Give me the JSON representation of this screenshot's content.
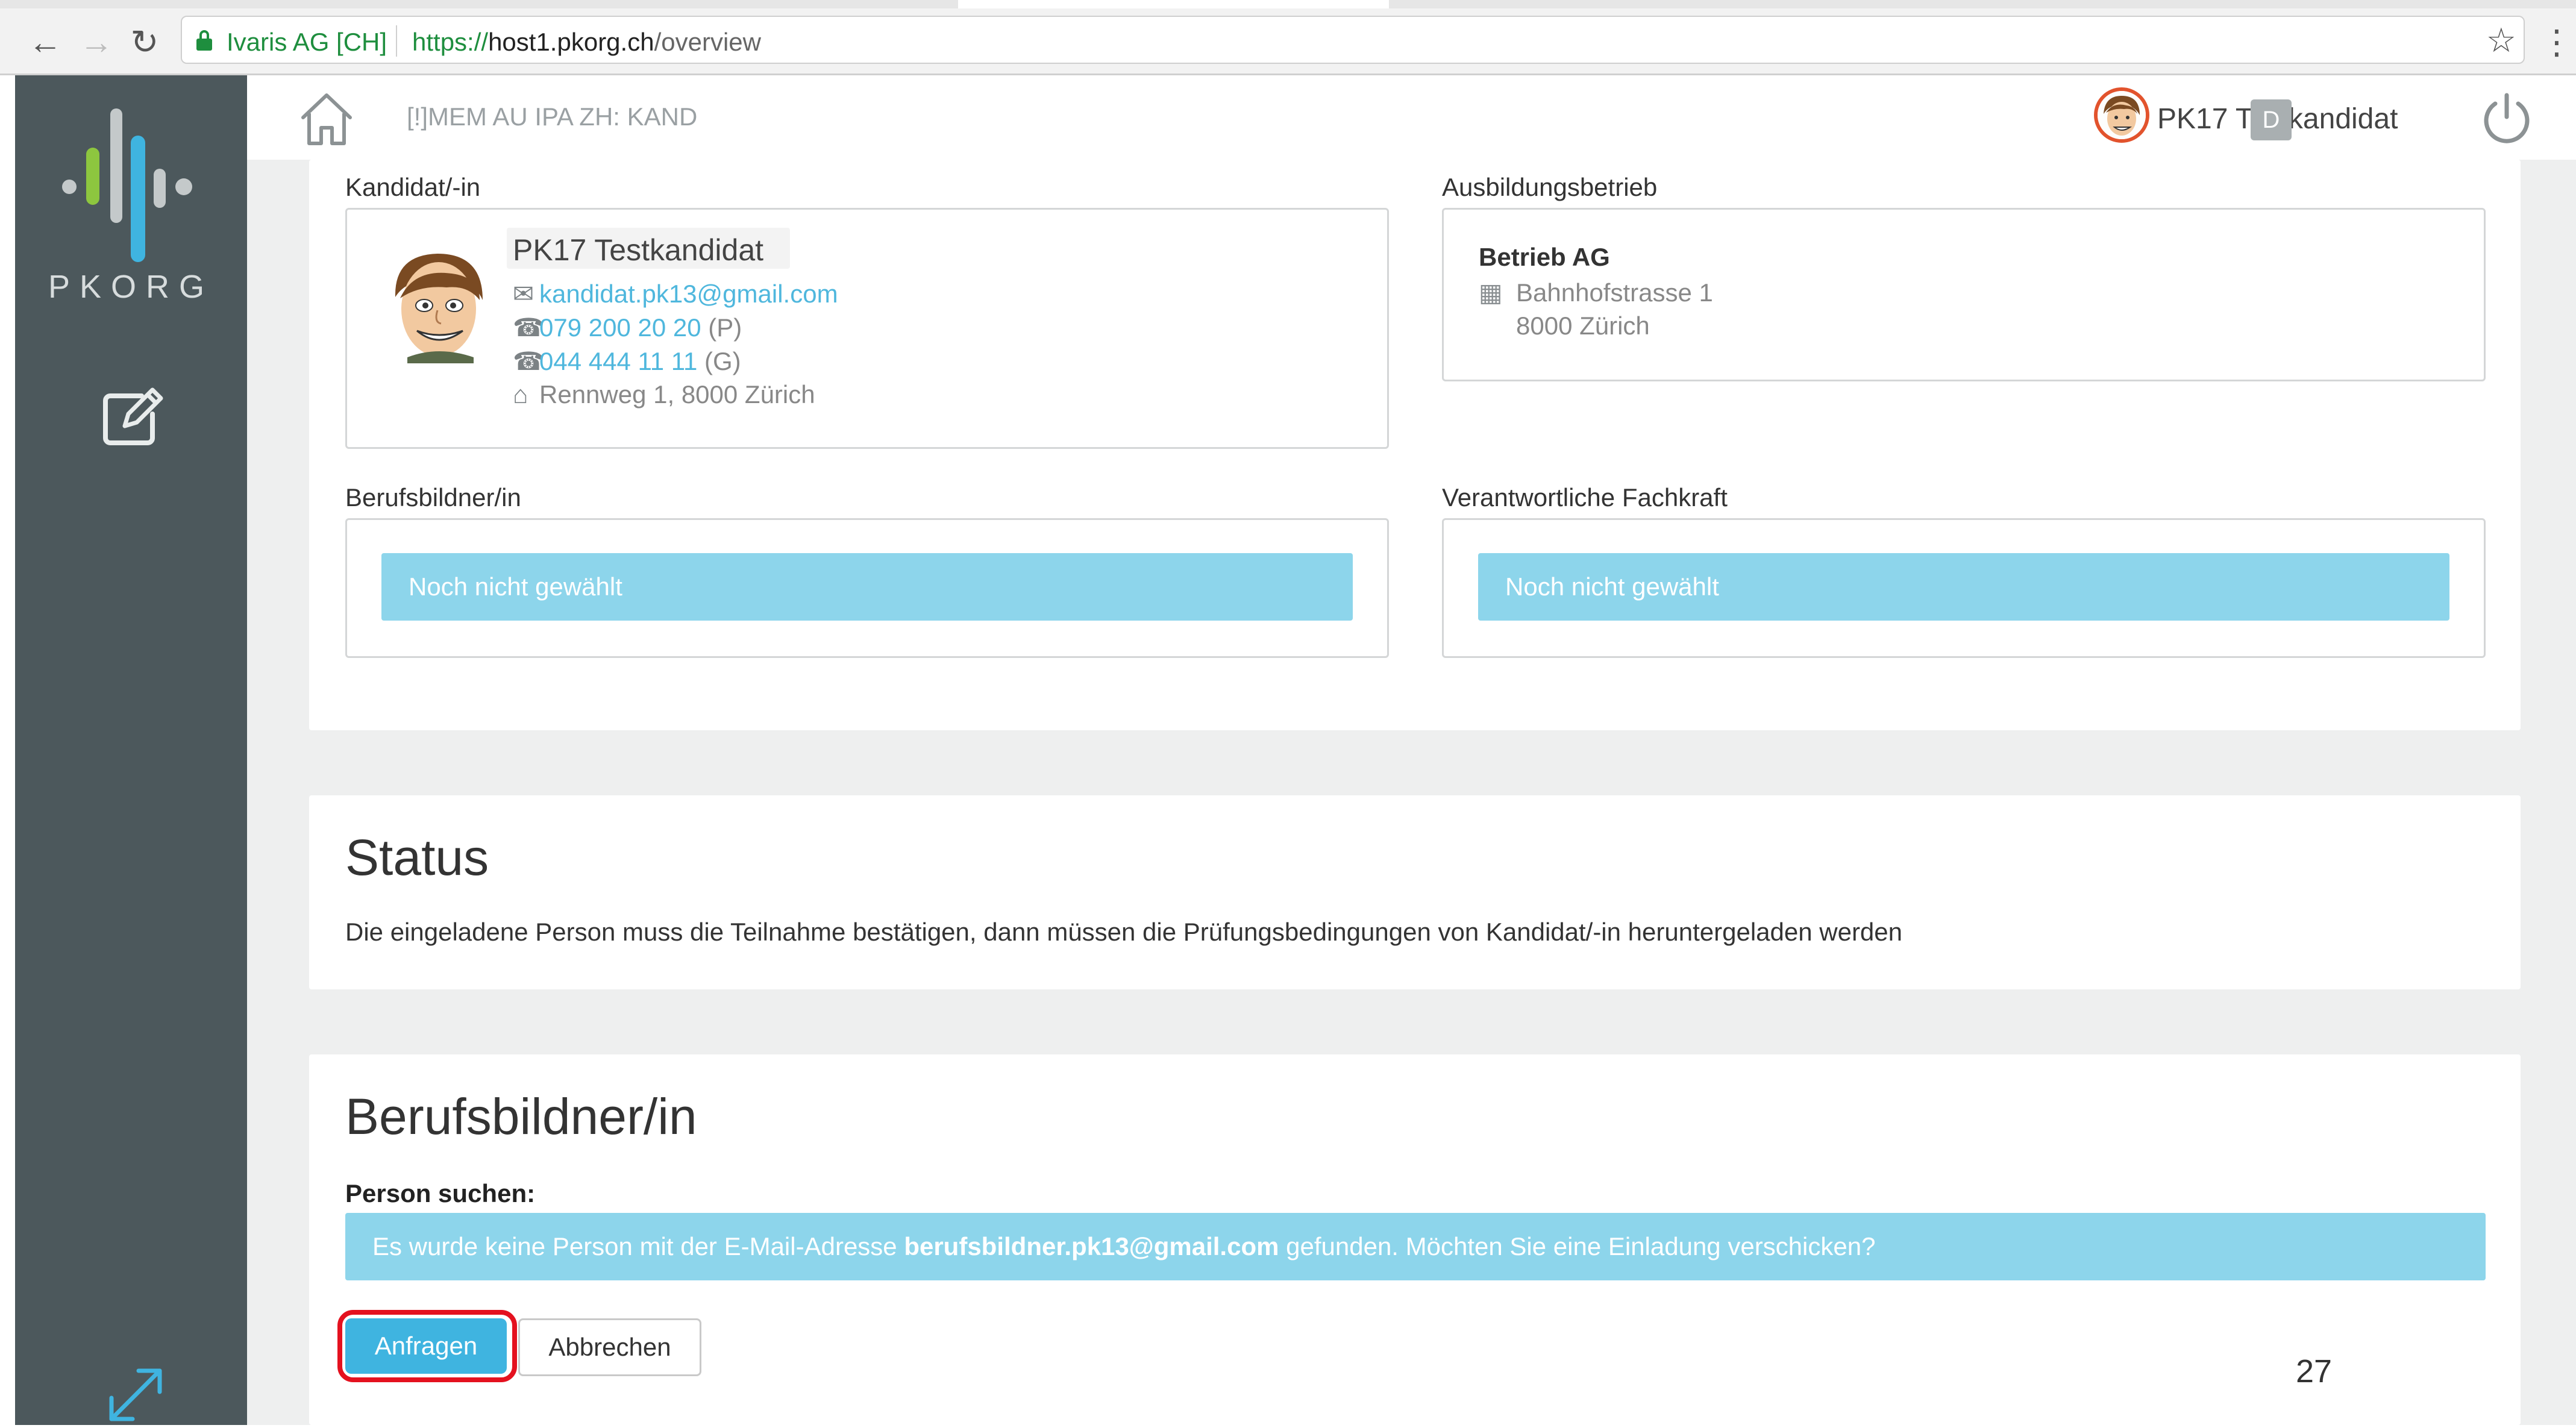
{
  "browser": {
    "site_identity": "Ivaris AG [CH]",
    "url_scheme": "https://",
    "url_host": "host1.pkorg.ch",
    "url_path": "/overview"
  },
  "sidebar": {
    "logo_text": "PKORG"
  },
  "header": {
    "context_label": "[!]MEM AU IPA ZH: KAND",
    "language_badge": "D",
    "user_name": "PK17 Testkandidat"
  },
  "candidate": {
    "section_label": "Kandidat/-in",
    "name": "PK17 Testkandidat",
    "email": "kandidat.pk13@gmail.com",
    "phone_private": "079 200 20 20",
    "phone_private_suffix": "(P)",
    "phone_business": "044 444 11 11",
    "phone_business_suffix": "(G)",
    "address": "Rennweg 1, 8000 Zürich"
  },
  "company": {
    "section_label": "Ausbildungsbetrieb",
    "name": "Betrieb AG",
    "street": "Bahnhofstrasse 1",
    "city": "8000 Zürich"
  },
  "trainer": {
    "section_label": "Berufsbildner/in",
    "placeholder": "Noch nicht gewählt"
  },
  "specialist": {
    "section_label": "Verantwortliche Fachkraft",
    "placeholder": "Noch nicht gewählt"
  },
  "status": {
    "title": "Status",
    "text": "Die eingeladene Person muss die Teilnahme bestätigen, dann müssen die Prüfungsbedingungen von Kandidat/-in heruntergeladen werden"
  },
  "trainer_search": {
    "title": "Berufsbildner/in",
    "search_label": "Person suchen:",
    "message_prefix": "Es wurde keine Person mit der E-Mail-Adresse ",
    "message_email": "berufsbildner.pk13@gmail.com",
    "message_suffix": " gefunden. Möchten Sie eine Einladung verschicken?",
    "request_button": "Anfragen",
    "cancel_button": "Abbrechen"
  },
  "page_number": "27",
  "colors": {
    "sidebar": "#4c585c",
    "accent": "#3fb4e0",
    "info_bar": "#8dd5eb",
    "highlight": "#e4111f"
  }
}
